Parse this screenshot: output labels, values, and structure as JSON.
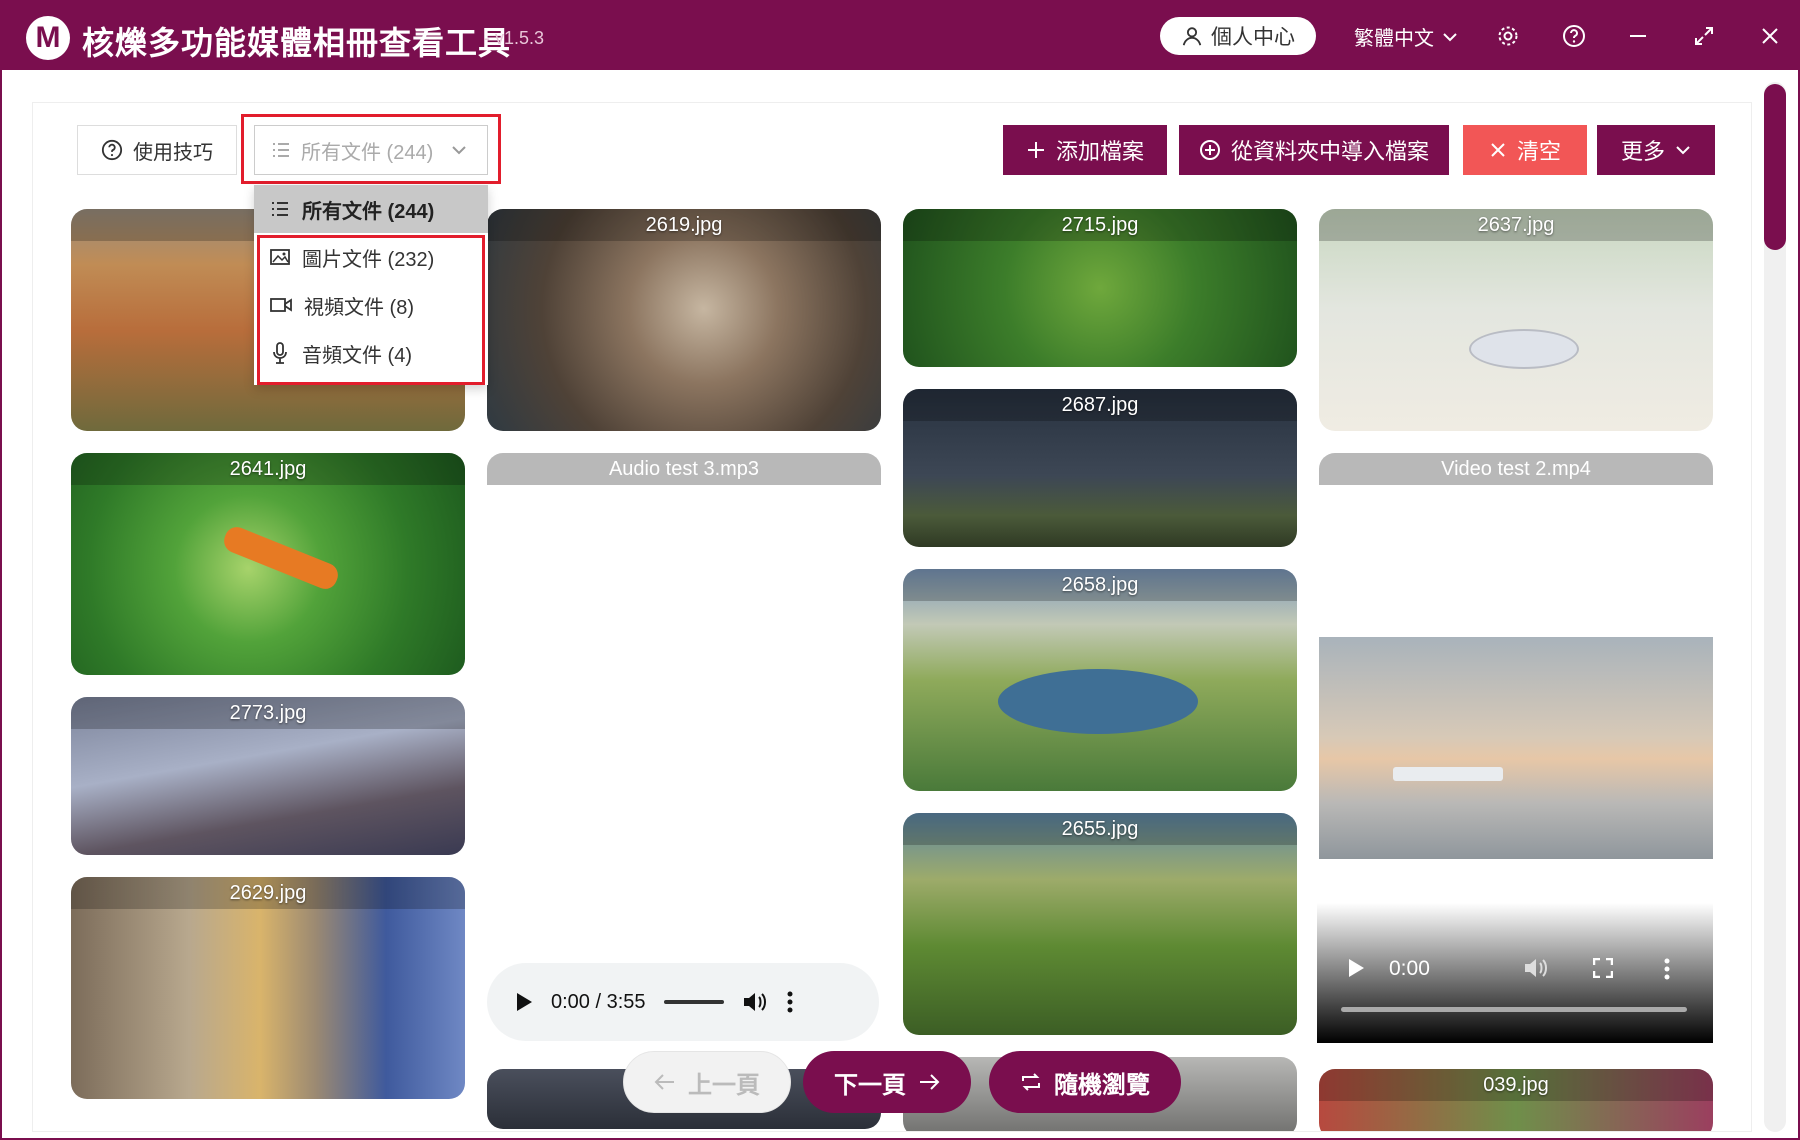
{
  "window": {
    "title": "核爍多功能媒體相冊查看工具",
    "version": "- v1.5.3",
    "user_center": "個人中心",
    "language": "繁體中文",
    "icons": [
      "gear-icon",
      "help-icon",
      "minimize-icon",
      "maximize-icon",
      "close-icon"
    ]
  },
  "toolbar": {
    "tips": "使用技巧",
    "filter_value": "所有文件 (244)",
    "add_file": "添加檔案",
    "import_folder": "從資料夾中導入檔案",
    "clear": "清空",
    "more": "更多"
  },
  "dropdown": {
    "options": [
      {
        "label": "所有文件 (244)",
        "icon": "list-icon"
      },
      {
        "label": "圖片文件 (232)",
        "icon": "image-icon"
      },
      {
        "label": "視頻文件 (8)",
        "icon": "video-icon"
      },
      {
        "label": "音頻文件 (4)",
        "icon": "microphone-icon"
      }
    ]
  },
  "gallery": {
    "col1": [
      "27",
      "2641.jpg",
      "2773.jpg",
      "2629.jpg"
    ],
    "col2": [
      "2619.jpg",
      "Audio test 3.mp3"
    ],
    "col3": [
      "2715.jpg",
      "2687.jpg",
      "2658.jpg",
      "2655.jpg"
    ],
    "col4": [
      "2637.jpg",
      "Video test 2.mp4",
      "039.jpg"
    ]
  },
  "audio_player": {
    "time": "0:00 / 3:55"
  },
  "video_player": {
    "time": "0:00"
  },
  "nav": {
    "prev": "上一頁",
    "next": "下一頁",
    "random": "隨機瀏覽"
  },
  "colors": {
    "brand": "#7a0e4e",
    "clear": "#f25656",
    "highlight": "#e21d2c"
  }
}
